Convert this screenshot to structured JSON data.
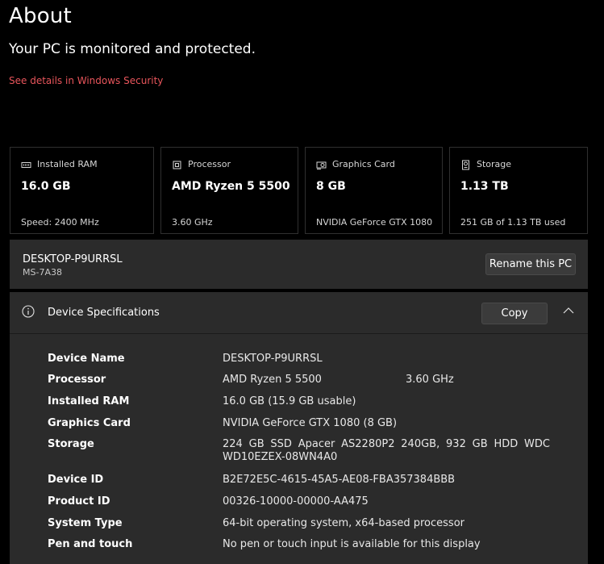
{
  "page": {
    "title": "About",
    "status": "Your PC is monitored and protected.",
    "security_link": "See details in Windows Security"
  },
  "cards": [
    {
      "icon": "ram-icon",
      "label": "Installed RAM",
      "value": "16.0 GB",
      "sub": "Speed: 2400 MHz"
    },
    {
      "icon": "processor-icon",
      "label": "Processor",
      "value": "AMD Ryzen 5 5500",
      "sub": "3.60 GHz"
    },
    {
      "icon": "graphics-card-icon",
      "label": "Graphics Card",
      "value": "8 GB",
      "sub": "NVIDIA GeForce GTX 1080"
    },
    {
      "icon": "storage-icon",
      "label": "Storage",
      "value": "1.13 TB",
      "sub": "251 GB of 1.13 TB used"
    }
  ],
  "device": {
    "name": "DESKTOP-P9URRSL",
    "model": "MS-7A38",
    "rename_label": "Rename this PC"
  },
  "specs": {
    "title": "Device Specifications",
    "copy_label": "Copy",
    "rows": [
      {
        "label": "Device Name",
        "value": "DESKTOP-P9URRSL"
      },
      {
        "label": "Processor",
        "value": "AMD Ryzen 5 5500",
        "value2": "3.60 GHz"
      },
      {
        "label": "Installed RAM",
        "value": "16.0 GB (15.9 GB usable)"
      },
      {
        "label": "Graphics Card",
        "value": "NVIDIA GeForce GTX 1080 (8 GB)"
      },
      {
        "label": "Storage",
        "value": "224 GB SSD Apacer AS2280P2 240GB, 932 GB HDD WDC WD10EZEX-08WN4A0"
      },
      {
        "label": "Device ID",
        "value": "B2E72E5C-4615-45A5-AE08-FBA357384BBB"
      },
      {
        "label": "Product ID",
        "value": "00326-10000-00000-AA475"
      },
      {
        "label": "System Type",
        "value": "64-bit operating system, x64-based processor"
      },
      {
        "label": "Pen and touch",
        "value": "No pen or touch input is available for this display"
      }
    ]
  },
  "colors": {
    "background": "#000000",
    "panel": "#2b2b2b",
    "link": "#e8555b",
    "card_border": "#2f2f2f"
  }
}
